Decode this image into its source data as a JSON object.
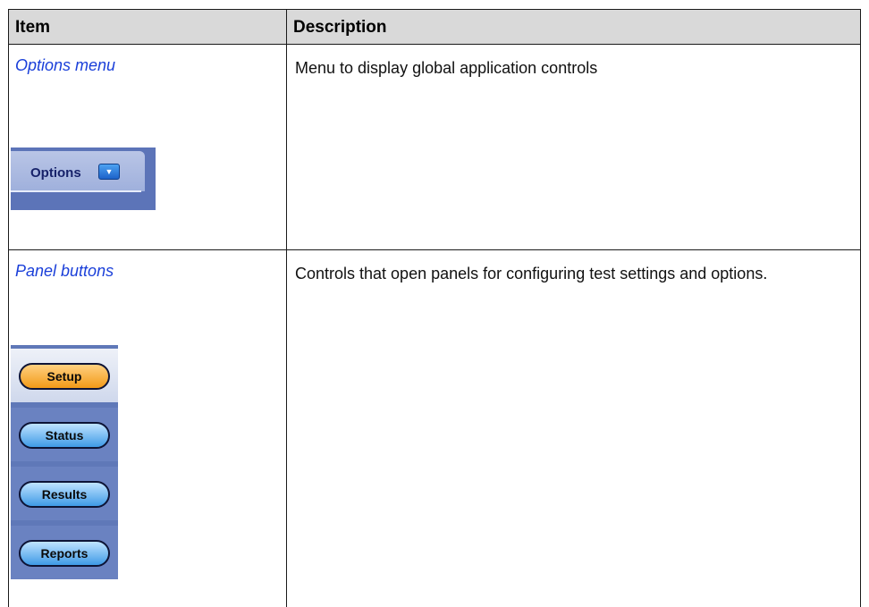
{
  "table": {
    "headers": {
      "item": "Item",
      "description": "Description"
    },
    "rows": [
      {
        "item": "Options menu",
        "description": "Menu to display global application controls",
        "image": {
          "label": "Options",
          "arrow_icon": "dropdown-arrow-icon"
        }
      },
      {
        "item": "Panel buttons",
        "description": "Controls that open panels for configuring test settings and options.",
        "image": {
          "buttons": [
            {
              "label": "Setup",
              "active": true
            },
            {
              "label": "Status",
              "active": false
            },
            {
              "label": "Results",
              "active": false
            },
            {
              "label": "Reports",
              "active": false
            }
          ]
        }
      }
    ]
  },
  "colors": {
    "link": "#1a3fd9",
    "header_bg": "#d9d9d9",
    "active_button": "#f29a18",
    "inactive_button": "#3f9ae6",
    "panel_bg": "#5f78b8"
  }
}
